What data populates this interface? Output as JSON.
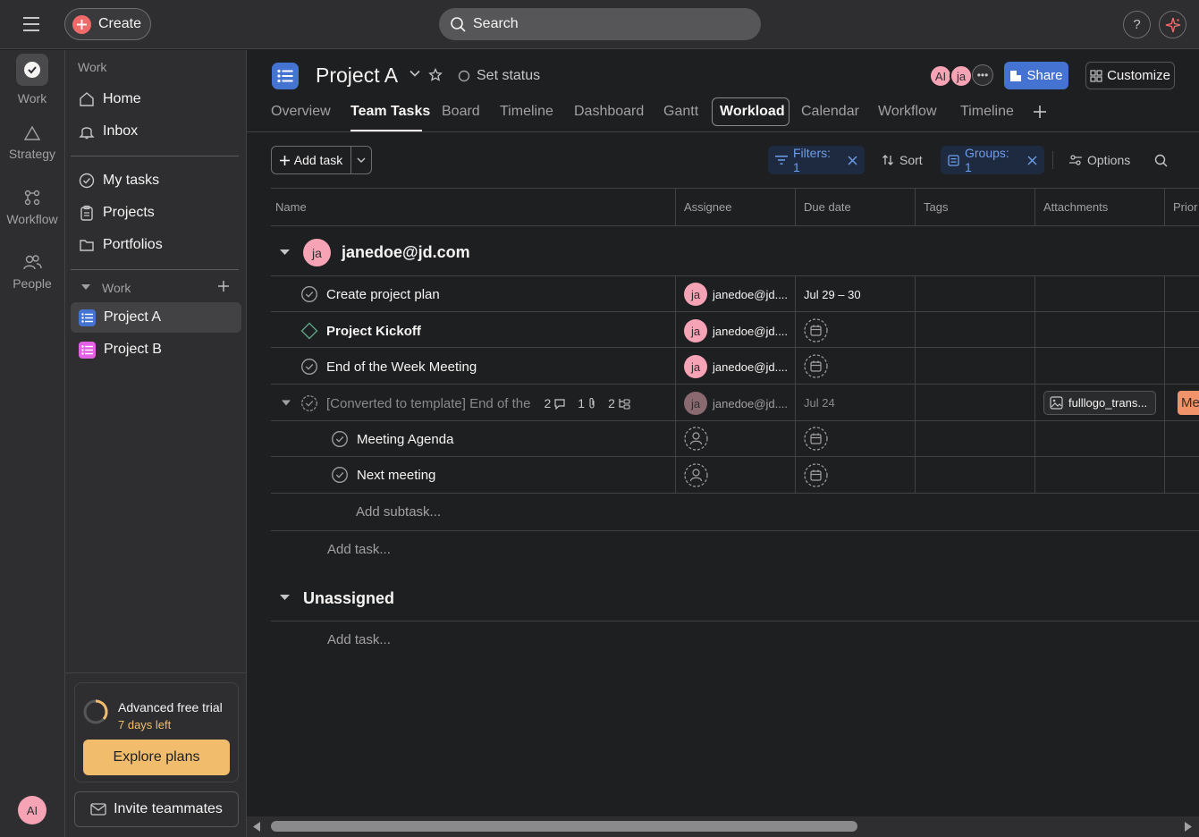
{
  "topbar": {
    "create_label": "Create",
    "search_placeholder": "Search",
    "help_label": "?"
  },
  "rail": {
    "items": [
      {
        "label": "Work",
        "icon": "check-circle-icon"
      },
      {
        "label": "Strategy",
        "icon": "triangle-icon"
      },
      {
        "label": "Workflow",
        "icon": "workflow-icon"
      },
      {
        "label": "People",
        "icon": "people-icon"
      }
    ],
    "user_initials": "AI"
  },
  "sidebar": {
    "section_label": "Work",
    "home": "Home",
    "inbox": "Inbox",
    "my_tasks": "My tasks",
    "projects": "Projects",
    "portfolios": "Portfolios",
    "team_heading": "Work",
    "project_a": "Project A",
    "project_b": "Project B",
    "trial_title": "Advanced free trial",
    "trial_days": "7 days left",
    "explore_label": "Explore plans",
    "invite_label": "Invite teammates"
  },
  "header": {
    "title": "Project A",
    "set_status": "Set status",
    "avatar_1": "AI",
    "avatar_2": "ja",
    "share_label": "Share",
    "customize_label": "Customize",
    "tabs": [
      "Overview",
      "Team Tasks",
      "Board",
      "Timeline",
      "Dashboard",
      "Gantt",
      "Workload",
      "Calendar",
      "Workflow",
      "Timeline"
    ],
    "active_tab": "Team Tasks"
  },
  "toolbar": {
    "add_task": "Add task",
    "filters": "Filters: 1",
    "sort": "Sort",
    "groups": "Groups: 1",
    "options": "Options"
  },
  "table": {
    "columns": [
      "Name",
      "Assignee",
      "Due date",
      "Tags",
      "Attachments",
      "Prior"
    ],
    "group_1": {
      "title": "janedoe@jd.com",
      "avatar": "ja",
      "rows": [
        {
          "name": "Create project plan",
          "assignee": "janedoe@jd....",
          "avatar": "ja",
          "due": "Jul 29 – 30"
        },
        {
          "name": "Project Kickoff",
          "assignee": "janedoe@jd....",
          "avatar": "ja",
          "due": ""
        },
        {
          "name": "End of the Week Meeting",
          "assignee": "janedoe@jd....",
          "avatar": "ja",
          "due": ""
        },
        {
          "name": "[Converted to template] End of the",
          "assignee": "janedoe@jd....",
          "avatar": "ja",
          "due": "Jul 24",
          "comments": "2",
          "attachments_count": "1",
          "subtasks_count": "2",
          "attachment_file": "fulllogo_trans...",
          "priority": "Me"
        },
        {
          "name": "Meeting Agenda",
          "assignee": "",
          "due": ""
        },
        {
          "name": "Next meeting",
          "assignee": "",
          "due": ""
        }
      ],
      "add_subtask": "Add subtask...",
      "add_task": "Add task..."
    },
    "group_2": {
      "title": "Unassigned",
      "add_task": "Add task..."
    }
  },
  "colors": {
    "accent_blue": "#4573d2",
    "create_red": "#f06a6a",
    "avatar_pink": "#f5a3b5",
    "trial_orange": "#f1bd6c",
    "milestone_green": "#5da283",
    "priority_orange": "#f0926a"
  }
}
